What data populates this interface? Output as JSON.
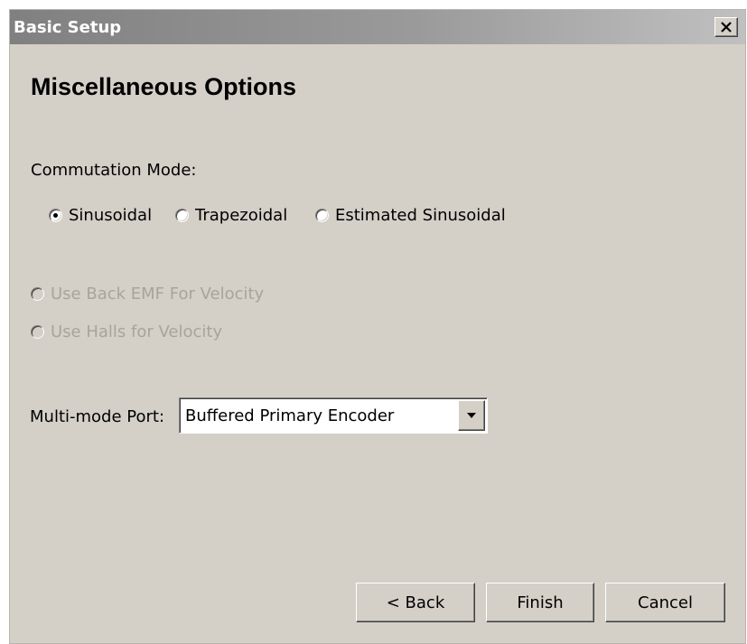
{
  "window": {
    "title": "Basic Setup",
    "close_icon": "close-icon"
  },
  "page": {
    "heading": "Miscellaneous Options"
  },
  "commutation": {
    "label": "Commutation Mode:",
    "options": [
      {
        "label": "Sinusoidal",
        "checked": true
      },
      {
        "label": "Trapezoidal",
        "checked": false
      },
      {
        "label": "Estimated Sinusoidal",
        "checked": false
      }
    ]
  },
  "velocity": {
    "options": [
      {
        "label": "Use Back EMF For Velocity",
        "enabled": false
      },
      {
        "label": "Use Halls for Velocity",
        "enabled": false
      }
    ]
  },
  "multimode": {
    "label": "Multi-mode Port:",
    "selected": "Buffered Primary Encoder",
    "arrow_icon": "dropdown-arrow-icon"
  },
  "buttons": {
    "back": "< Back",
    "finish": "Finish",
    "cancel": "Cancel"
  },
  "colors": {
    "face": "#d4d0c8",
    "title_bar": "#808080",
    "disabled_text": "#a8a49c"
  }
}
